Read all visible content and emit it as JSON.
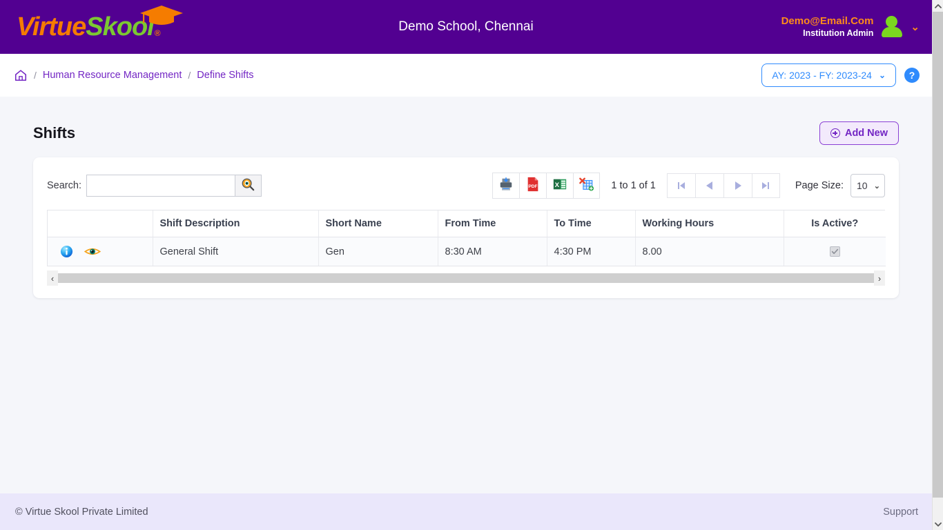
{
  "header": {
    "logo_part1": "Virtue",
    "logo_part2": "Skool",
    "logo_registered": "®",
    "school_title": "Demo School, Chennai",
    "user_email": "Demo@Email.Com",
    "user_role": "Institution Admin",
    "caret": "⌄"
  },
  "breadcrumb": {
    "home_icon": "home-icon",
    "sep": "/",
    "items": [
      {
        "label": "Human Resource Management"
      },
      {
        "label": "Define Shifts"
      }
    ],
    "ay_selector": "AY: 2023 - FY: 2023-24",
    "ay_caret": "⌄",
    "help_label": "?"
  },
  "page": {
    "title": "Shifts",
    "add_new_label": "Add New"
  },
  "toolbar": {
    "search_label": "Search:",
    "search_value": "",
    "search_placeholder": "",
    "search_icon": "magnifier-icon",
    "exports": [
      {
        "name": "print-export-button",
        "label": "Print"
      },
      {
        "name": "pdf-export-button",
        "label": "PDF"
      },
      {
        "name": "excel-export-button",
        "label": "Excel"
      },
      {
        "name": "xml-export-button",
        "label": "XML"
      }
    ],
    "range_text": "1 to 1 of 1",
    "pager": [
      {
        "name": "first-page-button",
        "glyph": "first"
      },
      {
        "name": "prev-page-button",
        "glyph": "prev"
      },
      {
        "name": "next-page-button",
        "glyph": "next"
      },
      {
        "name": "last-page-button",
        "glyph": "last"
      }
    ],
    "page_size_label": "Page Size:",
    "page_size_value": "10",
    "page_size_caret": "⌄"
  },
  "table": {
    "columns": [
      "",
      "Shift Description",
      "Short Name",
      "From Time",
      "To Time",
      "Working Hours",
      "Is Active?"
    ],
    "rows": [
      {
        "info_icon": "info-icon",
        "view_icon": "eye-icon",
        "shift_description": "General Shift",
        "short_name": "Gen",
        "from_time": "8:30 AM",
        "to_time": "4:30 PM",
        "working_hours": "8.00",
        "is_active": true
      }
    ]
  },
  "scrollbar": {
    "left_arrow": "‹",
    "right_arrow": "›"
  },
  "footer": {
    "copyright": "© Virtue Skool Private Limited",
    "support": "Support"
  },
  "colors": {
    "brand_purple": "#520091",
    "logo_orange": "#f57c00",
    "logo_green": "#7cc832",
    "link_purple": "#7326c4",
    "accent_blue": "#2f8bfd",
    "footer_bg": "#eae7fb",
    "page_bg": "#f5f6fa"
  }
}
